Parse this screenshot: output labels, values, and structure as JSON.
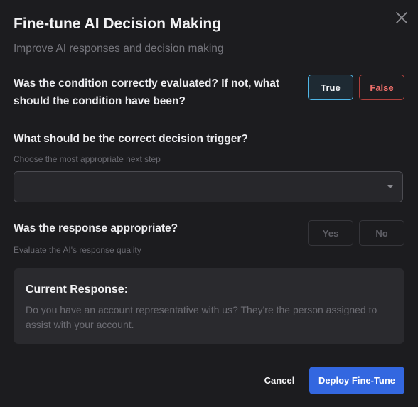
{
  "dialog": {
    "title": "Fine-tune AI Decision Making",
    "subtitle": "Improve AI responses and decision making",
    "close_icon": "close-icon"
  },
  "condition": {
    "question": "Was the condition correctly evaluated? If not, what should the condition have been?",
    "options": [
      "True",
      "False"
    ],
    "selected": "True",
    "colors": {
      "true_border": "#4fb6e6",
      "false_text": "#ee6f6a"
    }
  },
  "trigger": {
    "question": "What should be the correct decision trigger?",
    "hint": "Choose the most appropriate next step",
    "selected_value": "",
    "caret_icon": "chevron-down-icon"
  },
  "response_check": {
    "question": "Was the response appropriate?",
    "hint": "Evaluate the AI's response quality",
    "options": [
      "Yes",
      "No"
    ]
  },
  "current_response": {
    "heading": "Current Response:",
    "text": "Do you have an account representative with us? They're the person assigned to assist with your account."
  },
  "footer": {
    "cancel_label": "Cancel",
    "deploy_label": "Deploy Fine-Tune",
    "accent_color": "#3367e0"
  }
}
